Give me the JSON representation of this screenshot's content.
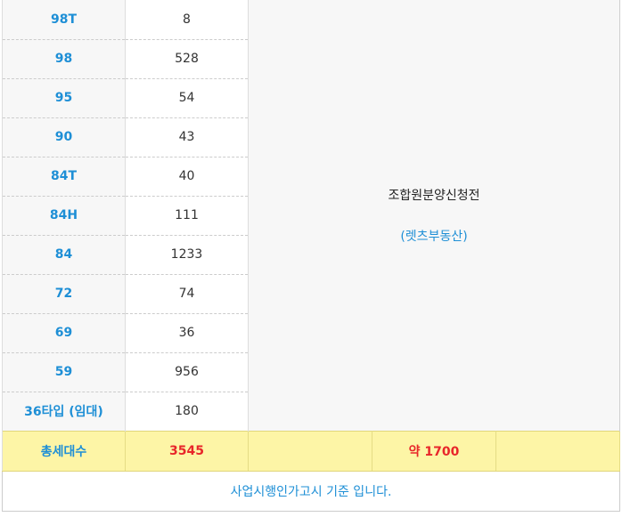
{
  "rows": [
    {
      "type": "98T",
      "count": "8"
    },
    {
      "type": "98",
      "count": "528"
    },
    {
      "type": "95",
      "count": "54"
    },
    {
      "type": "90",
      "count": "43"
    },
    {
      "type": "84T",
      "count": "40"
    },
    {
      "type": "84H",
      "count": "111"
    },
    {
      "type": "84",
      "count": "1233"
    },
    {
      "type": "72",
      "count": "74"
    },
    {
      "type": "69",
      "count": "36"
    },
    {
      "type": "59",
      "count": "956"
    },
    {
      "type": "36타입 (임대)",
      "count": "180"
    }
  ],
  "note": {
    "title": "조합원분양신청전",
    "source": "(렛츠부동산)"
  },
  "total": {
    "label": "총세대수",
    "count": "3545",
    "approx": "약 1700"
  },
  "footer": "사업시행인가고시 기준 입니다."
}
